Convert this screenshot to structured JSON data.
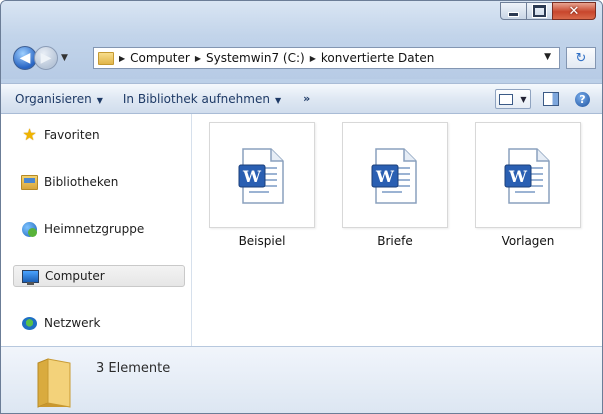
{
  "window": {
    "controls": {
      "minimize": "minimize",
      "maximize": "maximize",
      "close": "close"
    }
  },
  "address": {
    "crumbs": [
      "Computer",
      "Systemwin7 (C:)",
      "konvertierte Daten"
    ]
  },
  "toolbar": {
    "organize_label": "Organisieren",
    "library_label": "In Bibliothek aufnehmen",
    "more_label": "»"
  },
  "sidebar": {
    "items": [
      {
        "label": "Favoriten",
        "icon": "star-icon"
      },
      {
        "label": "Bibliotheken",
        "icon": "library-icon"
      },
      {
        "label": "Heimnetzgruppe",
        "icon": "homegroup-icon"
      },
      {
        "label": "Computer",
        "icon": "computer-icon",
        "selected": true
      },
      {
        "label": "Netzwerk",
        "icon": "network-icon"
      }
    ]
  },
  "files": [
    {
      "name": "Beispiel",
      "icon": "word-document-icon"
    },
    {
      "name": "Briefe",
      "icon": "word-document-icon"
    },
    {
      "name": "Vorlagen",
      "icon": "word-document-icon"
    }
  ],
  "details": {
    "status": "3 Elemente"
  },
  "colors": {
    "accent": "#2b5797",
    "word_blue": "#2a5fb2",
    "folder_yellow": "#e9c25a"
  }
}
